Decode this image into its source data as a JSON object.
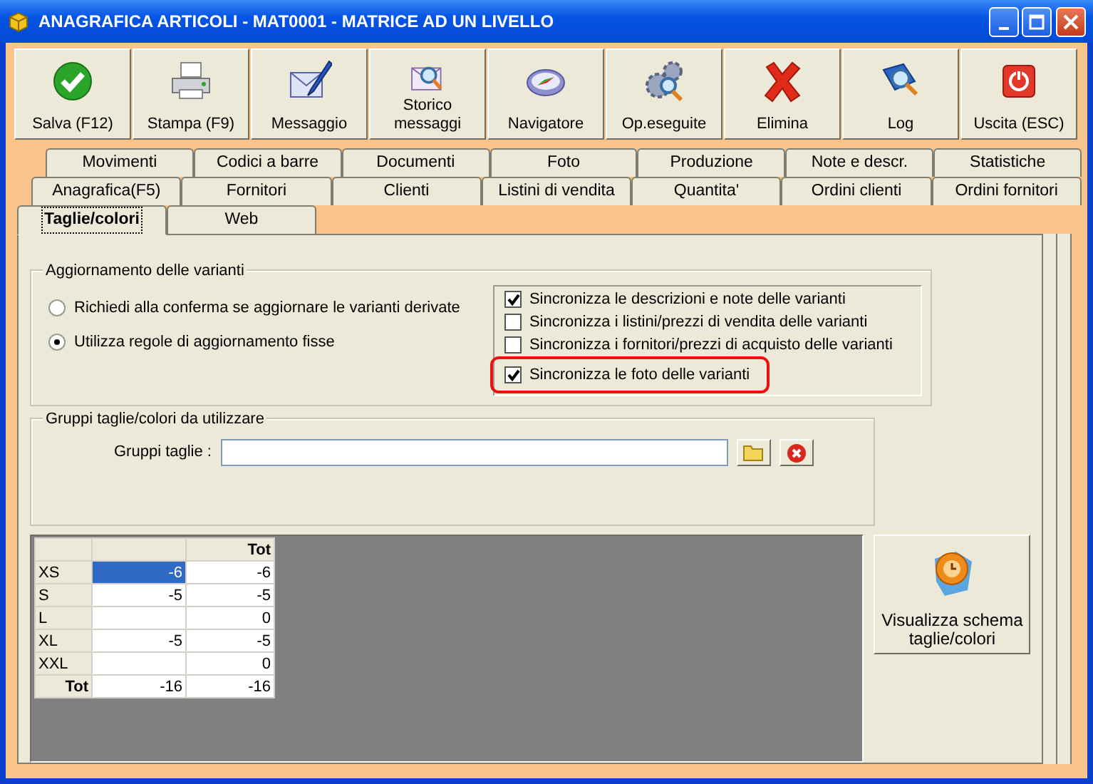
{
  "window": {
    "title": "ANAGRAFICA ARTICOLI - MAT0001 - MATRICE AD UN LIVELLO"
  },
  "toolbar": [
    {
      "label": "Salva (F12)"
    },
    {
      "label": "Stampa (F9)"
    },
    {
      "label": "Messaggio"
    },
    {
      "label": "Storico messaggi"
    },
    {
      "label": "Navigatore"
    },
    {
      "label": "Op.eseguite"
    },
    {
      "label": "Elimina"
    },
    {
      "label": "Log"
    },
    {
      "label": "Uscita (ESC)"
    }
  ],
  "tab_rows": [
    [
      {
        "label": "Movimenti",
        "selected": false
      },
      {
        "label": "Codici a barre",
        "selected": false
      },
      {
        "label": "Documenti",
        "selected": false
      },
      {
        "label": "Foto",
        "selected": false
      },
      {
        "label": "Produzione",
        "selected": false
      },
      {
        "label": "Note e descr.",
        "selected": false
      },
      {
        "label": "Statistiche",
        "selected": false
      }
    ],
    [
      {
        "label": "Anagrafica(F5)",
        "selected": false
      },
      {
        "label": "Fornitori",
        "selected": false
      },
      {
        "label": "Clienti",
        "selected": false
      },
      {
        "label": "Listini di vendita",
        "selected": false
      },
      {
        "label": "Quantita'",
        "selected": false
      },
      {
        "label": "Ordini clienti",
        "selected": false
      },
      {
        "label": "Ordini fornitori",
        "selected": false
      }
    ],
    [
      {
        "label": "Taglie/colori",
        "selected": true
      },
      {
        "label": "Web",
        "selected": false
      }
    ]
  ],
  "update_group": {
    "title": "Aggiornamento delle varianti",
    "radios": [
      {
        "label": "Richiedi alla conferma se aggiornare le varianti derivate",
        "selected": false
      },
      {
        "label": "Utilizza regole di aggiornamento fisse",
        "selected": true
      }
    ],
    "checkboxes": [
      {
        "label": "Sincronizza le descrizioni e note delle varianti",
        "checked": true,
        "highlighted": false
      },
      {
        "label": "Sincronizza i listini/prezzi di vendita delle varianti",
        "checked": false,
        "highlighted": false
      },
      {
        "label": "Sincronizza i fornitori/prezzi di acquisto delle varianti",
        "checked": false,
        "highlighted": false
      },
      {
        "label": "Sincronizza le foto delle varianti",
        "checked": true,
        "highlighted": true
      }
    ]
  },
  "groups_group": {
    "title": "Gruppi taglie/colori da utilizzare",
    "field_label": "Gruppi taglie :"
  },
  "grid": {
    "total_column": "Tot",
    "rows": [
      {
        "label": "XS",
        "kind": "size",
        "cells": [
          {
            "text": "-6",
            "selected": true
          },
          {
            "text": "-6",
            "selected": false
          }
        ]
      },
      {
        "label": "S",
        "kind": "size",
        "cells": [
          {
            "text": "-5",
            "selected": false
          },
          {
            "text": "-5",
            "selected": false
          }
        ]
      },
      {
        "label": "L",
        "kind": "size",
        "cells": [
          {
            "selected": false
          },
          {
            "text": "0",
            "selected": false
          }
        ]
      },
      {
        "label": "XL",
        "kind": "size",
        "cells": [
          {
            "text": "-5",
            "selected": false
          },
          {
            "text": "-5",
            "selected": false
          }
        ]
      },
      {
        "label": "XXL",
        "kind": "size",
        "cells": [
          {
            "selected": false
          },
          {
            "text": "0",
            "selected": false
          }
        ]
      },
      {
        "label": "Tot",
        "kind": "total",
        "cells": [
          {
            "text": "-16",
            "selected": false
          },
          {
            "text": "-16",
            "selected": false
          }
        ]
      }
    ]
  },
  "schema_button": {
    "label": "Visualizza schema taglie/colori"
  }
}
